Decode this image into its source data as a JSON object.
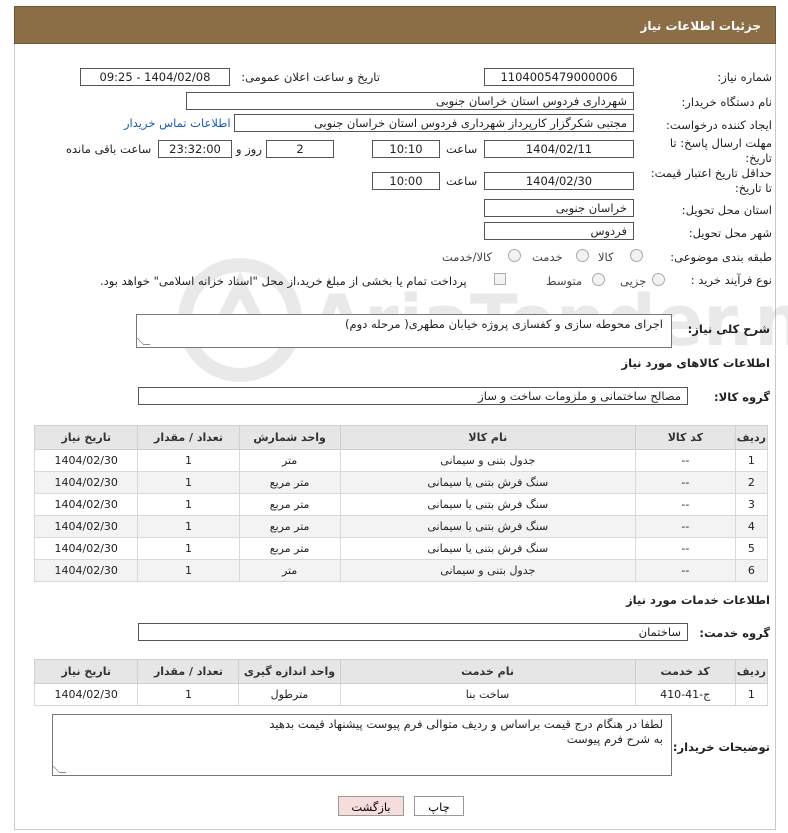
{
  "header": {
    "title": "جزئیات اطلاعات نیاز"
  },
  "fields": {
    "need_number_label": "شماره نیاز:",
    "need_number": "1104005479000006",
    "announce_label": "تاریخ و ساعت اعلان عمومی:",
    "announce_value": "1404/02/08 - 09:25",
    "buyer_label": "نام دستگاه خریدار:",
    "buyer_value": "شهرداری فردوس استان خراسان جنوبی",
    "creator_label": "ایجاد کننده درخواست:",
    "creator_value": "مجتبی شکرگزار کارپرداز شهرداری فردوس استان خراسان جنوبی",
    "contact_link": "اطلاعات تماس خریدار",
    "deadline_label": "مهلت ارسال پاسخ: تا تاریخ:",
    "deadline_date": "1404/02/11",
    "time_label": "ساعت",
    "deadline_time": "10:10",
    "days_value": "2",
    "days_label": "روز و",
    "remaining_time": "23:32:00",
    "remaining_label": "ساعت باقی مانده",
    "min_price_label": "حداقل تاریخ اعتبار قیمت: تا تاریخ:",
    "min_price_date": "1404/02/30",
    "min_price_time": "10:00",
    "province_label": "استان محل تحویل:",
    "province_value": "خراسان جنوبی",
    "city_label": "شهر محل تحویل:",
    "city_value": "فردوس",
    "category_label": "طبقه بندی موضوعی:",
    "category_options": [
      "کالا",
      "خدمت",
      "کالا/خدمت"
    ],
    "process_label": "نوع فرآیند خرید :",
    "process_options": [
      "جزیی",
      "متوسط"
    ],
    "payment_note": "پرداخت تمام یا بخشی از مبلغ خرید،از محل \"اسناد خزانه اسلامی\" خواهد بود."
  },
  "description": {
    "label": "شرح کلی نیاز:",
    "value": "اجرای محوطه سازی و کفسازی پروژه خیابان مطهری( مرحله دوم)"
  },
  "goods": {
    "section_title": "اطلاعات کالاهای مورد نیاز",
    "group_label": "گروه کالا:",
    "group_value": "مصالح ساختمانی و ملزومات ساخت و ساز",
    "columns": [
      "ردیف",
      "کد کالا",
      "نام کالا",
      "واحد شمارش",
      "تعداد / مقدار",
      "تاریخ نیاز"
    ],
    "rows": [
      [
        "1",
        "--",
        "جدول بتنی و سیمانی",
        "متر",
        "1",
        "1404/02/30"
      ],
      [
        "2",
        "--",
        "سنگ فرش بتنی یا سیمانی",
        "متر مربع",
        "1",
        "1404/02/30"
      ],
      [
        "3",
        "--",
        "سنگ فرش بتنی یا سیمانی",
        "متر مربع",
        "1",
        "1404/02/30"
      ],
      [
        "4",
        "--",
        "سنگ فرش بتنی یا سیمانی",
        "متر مربع",
        "1",
        "1404/02/30"
      ],
      [
        "5",
        "--",
        "سنگ فرش بتنی یا سیمانی",
        "متر مربع",
        "1",
        "1404/02/30"
      ],
      [
        "6",
        "--",
        "جدول بتنی و سیمانی",
        "متر",
        "1",
        "1404/02/30"
      ]
    ]
  },
  "services": {
    "section_title": "اطلاعات خدمات مورد نیاز",
    "group_label": "گروه خدمت:",
    "group_value": "ساختمان",
    "columns": [
      "ردیف",
      "کد خدمت",
      "نام خدمت",
      "واحد اندازه گیری",
      "تعداد / مقدار",
      "تاریخ نیاز"
    ],
    "rows": [
      [
        "1",
        "ج-41-410",
        "ساخت بنا",
        "مترطول",
        "1",
        "1404/02/30"
      ]
    ]
  },
  "buyer_notes": {
    "label": "توضیحات خریدار:",
    "line1": "لطفا در هنگام درج قیمت براساس و ردیف متوالی فرم پیوست پیشنهاد قیمت بدهید",
    "line2": "به شرح فرم پیوست"
  },
  "buttons": {
    "print": "چاپ",
    "back": "بازگشت"
  },
  "colors": {
    "header_bg": "#8b6d46",
    "link": "#1a5bb8",
    "back_button": "#f7dcdc",
    "print_button": "#ffffff"
  }
}
